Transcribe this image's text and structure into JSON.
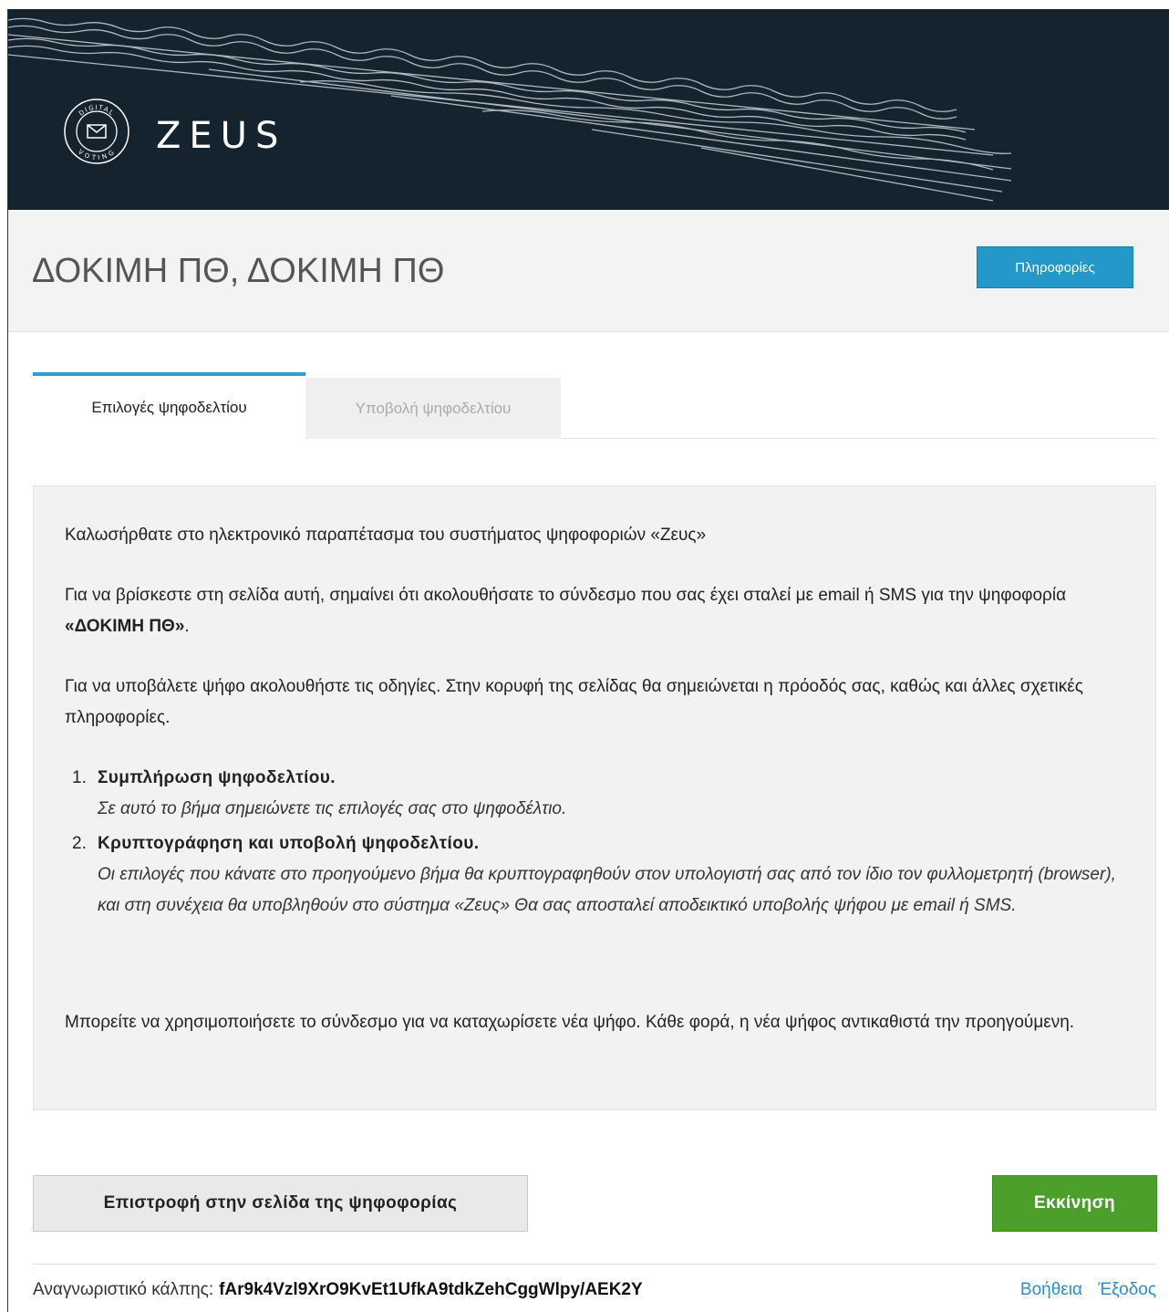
{
  "header": {
    "brand": "ZEUS",
    "logo": {
      "top_text": "DIGITAL",
      "bottom_text": "VOTING",
      "icon": "envelope-icon"
    }
  },
  "election": {
    "title": "ΔΟΚΙΜΗ ΠΘ, ΔΟΚΙΜΗ ΠΘ",
    "info_button": "Πληροφορίες"
  },
  "tabs": [
    {
      "label": "Επιλογές ψηφοδελτίου",
      "active": true
    },
    {
      "label": "Υποβολή ψηφοδελτίου",
      "active": false
    }
  ],
  "panel": {
    "welcome": "Καλωσήρθατε στο ηλεκτρονικό παραπέτασμα του συστήματος ψηφοφοριών «Ζευς»",
    "intro_text": "Για να βρίσκεστε στη σελίδα αυτή, σημαίνει ότι ακολουθήσατε το σύνδεσμο που σας έχει σταλεί με email ή SMS για την ψηφοφορία ",
    "intro_election": "«ΔΟΚΙΜΗ ΠΘ»",
    "intro_end": ".",
    "instructions": "Για να υποβάλετε ψήφο ακολουθήστε τις οδηγίες. Στην κορυφή της σελίδας θα σημειώνεται η πρόοδός σας, καθώς και άλλες σχετικές πληροφορίες.",
    "steps": [
      {
        "num": "1.",
        "title": "Συμπλήρωση ψηφοδελτίου.",
        "desc": "Σε αυτό το βήμα σημειώνετε τις επιλογές σας στο ψηφοδέλτιο."
      },
      {
        "num": "2.",
        "title": "Κρυπτογράφηση και υποβολή ψηφοδελτίου.",
        "desc": "Οι επιλογές που κάνατε στο προηγούμενο βήμα θα κρυπτογραφηθούν στον υπολογιστή σας από τον ίδιο τον φυλλομετρητή (browser), και στη συνέχεια θα υποβληθούν στο σύστημα «Ζευς» Θα σας αποσταλεί αποδεικτικό υποβολής ψήφου με email ή SMS."
      }
    ],
    "revote_note": "Μπορείτε να χρησιμοποιήσετε το σύνδεσμο για να καταχωρίσετε νέα ψήφο. Κάθε φορά, η νέα ψήφος αντικαθιστά την προηγούμενη."
  },
  "actions": {
    "back": "Επιστροφή στην σελίδα της ψηφοφορίας",
    "start": "Εκκίνηση"
  },
  "footer": {
    "booth_id_label": "Αναγνωριστικό κάλπης:",
    "booth_id_value": "fAr9k4Vzl9XrO9KvEt1UfkA9tdkZehCggWlpy/AEK2Y",
    "help": "Βοήθεια",
    "logout": "Έξοδος"
  },
  "colors": {
    "banner": "#14232e",
    "info_button": "#2499c9",
    "start_button": "#4d9f2c",
    "tab_accent": "#2d9fd0",
    "link": "#2d8fc9"
  }
}
